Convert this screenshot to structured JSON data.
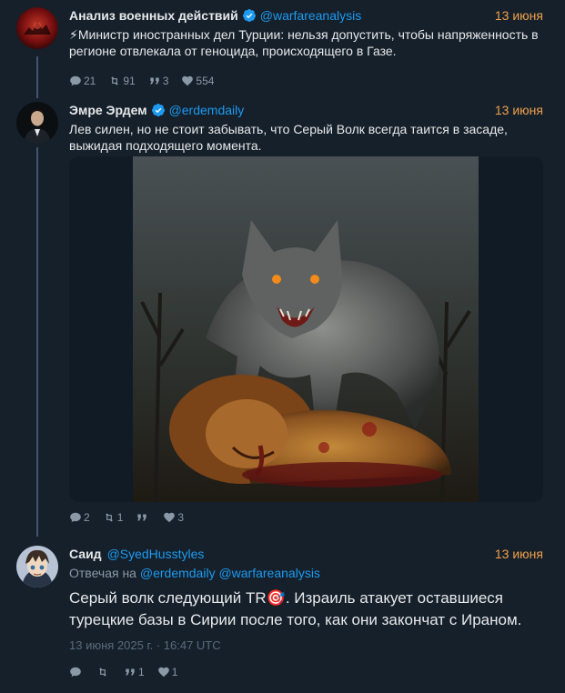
{
  "tweets": [
    {
      "name": "Анализ военных действий",
      "handle": "@warfareanalysis",
      "date": "13 июня",
      "text": "⚡Министр иностранных дел Турции: нельзя допустить, чтобы напряженность в регионе отвлекала от геноцида, происходящего в Газе.",
      "replies": "21",
      "retweets": "91",
      "quotes": "3",
      "likes": "554"
    },
    {
      "name": "Эмре Эрдем",
      "handle": "@erdemdaily",
      "date": "13 июня",
      "text": "Лев силен, но не стоит забывать, что Серый Волк всегда таится в засаде, выжидая подходящего момента.",
      "replies": "2",
      "retweets": "1",
      "quotes": "",
      "likes": "3"
    },
    {
      "name": "Саид",
      "handle": "@SyedHusstyles",
      "date": "13 июня",
      "replying_prefix": "Отвечая на",
      "replying_to_1": "@erdemdaily",
      "replying_to_2": "@warfareanalysis",
      "text": "Серый волк следующий TR🎯. Израиль атакует оставшиеся турецкие базы в Сирии после того, как они закончат с Ираном.",
      "timestamp": "13 июня 2025 г. · 16:47 UTC",
      "replies": "",
      "retweets": "",
      "quotes": "1",
      "likes": "1"
    }
  ],
  "colors": {
    "background": "#15202b",
    "handle": "#1d9bf0",
    "date": "#f0a04b",
    "muted": "#8b98a5"
  }
}
